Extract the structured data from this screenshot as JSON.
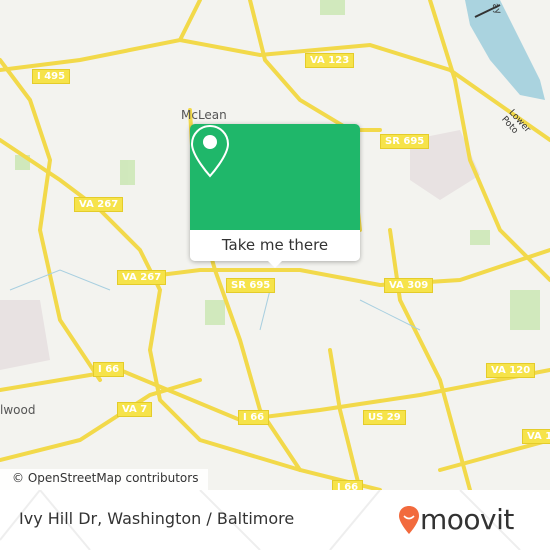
{
  "map": {
    "place_labels": [
      "McLean",
      "lwood"
    ],
    "road_labels": [
      "I 495",
      "VA 123",
      "SR 695",
      "SR 695",
      "VA 267",
      "VA 267",
      "VA 309",
      "I 66",
      "I 66",
      "I 66",
      "VA 7",
      "US 29",
      "VA 120",
      "VA 1"
    ],
    "water_labels": [
      "Lower Poto",
      "ay"
    ],
    "attribution": "© OpenStreetMap contributors",
    "colors": {
      "road": "#f6e34a",
      "water": "#aad3df",
      "park": "#c8e6b0",
      "land": "#f3f3ef"
    }
  },
  "popup": {
    "icon": "map-pin-icon",
    "button_label": "Take me there",
    "color": "#1fb76a"
  },
  "footer": {
    "location": "Ivy Hill Dr, Washington / Baltimore",
    "brand": "moovit",
    "brand_color": "#f26a3d"
  }
}
